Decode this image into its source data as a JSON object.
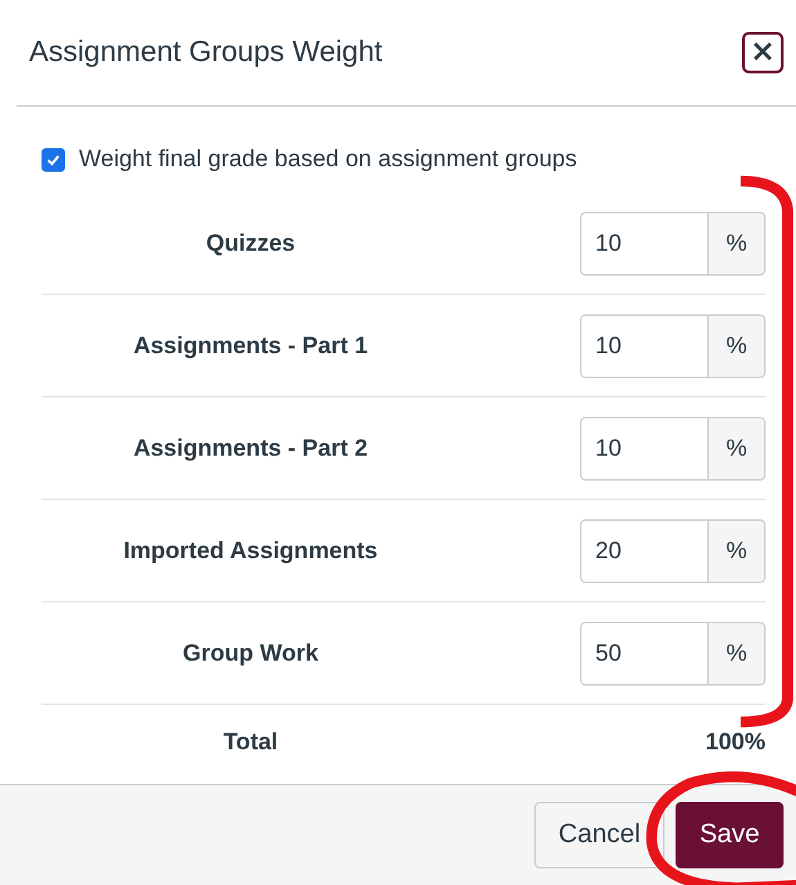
{
  "dialog": {
    "title": "Assignment Groups Weight",
    "close_label": "×"
  },
  "weight_option": {
    "label": "Weight final grade based on assignment groups",
    "checked": true
  },
  "groups": [
    {
      "name": "Quizzes",
      "value": "10",
      "unit": "%"
    },
    {
      "name": "Assignments - Part 1",
      "value": "10",
      "unit": "%"
    },
    {
      "name": "Assignments - Part 2",
      "value": "10",
      "unit": "%"
    },
    {
      "name": "Imported Assignments",
      "value": "20",
      "unit": "%"
    },
    {
      "name": "Group Work",
      "value": "50",
      "unit": "%"
    }
  ],
  "total": {
    "label": "Total",
    "value": "100%"
  },
  "buttons": [
    {
      "label": "Cancel",
      "kind": "secondary"
    },
    {
      "label": "Save",
      "kind": "primary"
    }
  ],
  "annotation_bracket": {
    "color": "#e8141c"
  },
  "annotation_ellipse": {
    "color": "#e8141c"
  }
}
